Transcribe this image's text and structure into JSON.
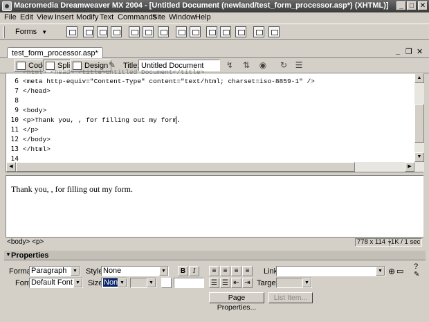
{
  "window": {
    "title": "Macromedia Dreamweaver MX 2004 - [Untitled Document (newland/test_form_processor.asp*) (XHTML)]",
    "minimize": "_",
    "maximize": "□",
    "close": "✕"
  },
  "menu": [
    "File",
    "Edit",
    "View",
    "Insert",
    "Modify",
    "Text",
    "Commands",
    "Site",
    "Window",
    "Help"
  ],
  "insert_toolbar": {
    "category": "Forms"
  },
  "document": {
    "tab_label": "test_form_processor.asp*",
    "win_minimize": "_",
    "win_restore": "❐",
    "win_close": "✕"
  },
  "doc_toolbar": {
    "code_label": "Code",
    "split_label": "Split",
    "design_label": "Design",
    "title_label": "Title:",
    "title_value": "Untitled Document"
  },
  "code": {
    "partial_line": "<html> <head> <title>Untitled Document</title>",
    "lines": [
      {
        "num": "6",
        "text": "<meta http-equiv=\"Content-Type\" content=\"text/html; charset=iso-8859-1\" />"
      },
      {
        "num": "7",
        "text": "</head>"
      },
      {
        "num": "8",
        "text": ""
      },
      {
        "num": "9",
        "text": "<body>"
      },
      {
        "num": "10",
        "text": "<p>Thank you, , for filling out my form."
      },
      {
        "num": "11",
        "text": "</p>"
      },
      {
        "num": "12",
        "text": "</body>"
      },
      {
        "num": "13",
        "text": "</html>"
      },
      {
        "num": "14",
        "text": ""
      }
    ]
  },
  "design": {
    "text": "Thank you, , for filling out my form."
  },
  "status": {
    "tags": "<body> <p>",
    "window_size": "778 x 114",
    "download": "1K / 1 sec"
  },
  "properties": {
    "title": "Properties",
    "format_label": "Format",
    "format_value": "Paragraph",
    "style_label": "Style",
    "style_value": "None",
    "bold": "B",
    "italic": "I",
    "link_label": "Link",
    "link_value": "",
    "font_label": "Font",
    "font_value": "Default Font",
    "size_label": "Size",
    "size_value": "None",
    "target_label": "Target",
    "page_properties": "Page Properties...",
    "list_item": "List Item..."
  }
}
